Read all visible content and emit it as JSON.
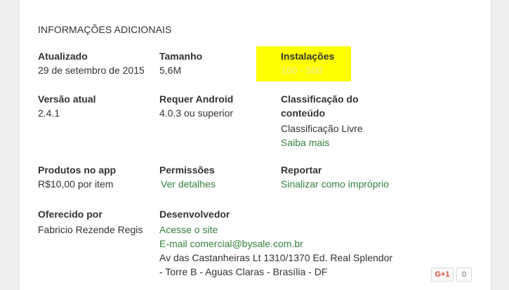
{
  "section": {
    "title": "INFORMAÇÕES ADICIONAIS"
  },
  "updated": {
    "label": "Atualizado",
    "value": "29 de setembro de 2015"
  },
  "size": {
    "label": "Tamanho",
    "value": "5,6M"
  },
  "installs": {
    "label": "Instalações",
    "value": "100 - 500",
    "highlight_color": "#ffff00"
  },
  "current_version": {
    "label": "Versão atual",
    "value": "2.4.1"
  },
  "requires_android": {
    "label": "Requer Android",
    "value": "4.0.3 ou superior"
  },
  "content_rating": {
    "label_line1": "Classificação do",
    "label_line2": "conteúdo",
    "value": "Classificação Livre",
    "link": "Saiba mais"
  },
  "in_app_products": {
    "label": "Produtos no app",
    "value": "R$10,00 por item"
  },
  "permissions": {
    "label": "Permissões",
    "link": "Ver detalhes"
  },
  "report": {
    "label": "Reportar",
    "link": "Sinalizar como impróprio"
  },
  "offered_by": {
    "label": "Oferecido por",
    "value": "Fabricio Rezende Regis"
  },
  "developer": {
    "label": "Desenvolvedor",
    "site_link": "Acesse o site",
    "email_link": "E-mail comercial@bysale.com.br",
    "address_line1": "Av das Castanheiras Lt 1310/1370 Ed. Real Splendor",
    "address_line2": "- Torre B - Aguas Claras - Brasília - DF"
  },
  "gplus": {
    "label": "G+1",
    "count": "0"
  },
  "colors": {
    "link": "#35803b",
    "text": "#333333",
    "background": "#efefef"
  }
}
